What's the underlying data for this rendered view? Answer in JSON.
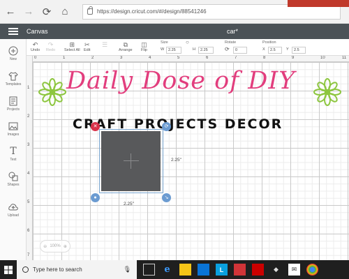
{
  "browser": {
    "url": "https://design.cricut.com/#/design/88541246"
  },
  "app": {
    "title": "Canvas",
    "document_name": "car*"
  },
  "left_panel": {
    "items": [
      {
        "label": "New",
        "icon": "plus-circle-icon"
      },
      {
        "label": "Templates",
        "icon": "shirt-icon"
      },
      {
        "label": "Projects",
        "icon": "projects-icon"
      },
      {
        "label": "Images",
        "icon": "image-icon"
      },
      {
        "label": "Text",
        "icon": "text-icon"
      },
      {
        "label": "Shapes",
        "icon": "shapes-icon"
      },
      {
        "label": "Upload",
        "icon": "upload-cloud-icon"
      }
    ]
  },
  "toolbar": {
    "undo": "Undo",
    "redo": "Redo",
    "select_all": "Select All",
    "edit": "Edit",
    "arrange": "Arrange",
    "flip": "Flip",
    "size_label": "Size",
    "w_label": "W",
    "h_label": "H",
    "width": "2.25",
    "height": "2.25",
    "rotate_label": "Rotate",
    "rotate": "0",
    "position_label": "Position",
    "x_label": "X",
    "y_label": "Y",
    "x": "2.5",
    "y": "2.5"
  },
  "ruler": {
    "top": [
      "0",
      "1",
      "2",
      "3",
      "4",
      "5",
      "6",
      "7",
      "8",
      "9",
      "10",
      "11"
    ],
    "left": [
      "1",
      "2",
      "3",
      "4",
      "5",
      "6",
      "7"
    ]
  },
  "overlay": {
    "title": "Daily Dose of DIY",
    "subtitle": "CRAFT PROJECTS DECOR",
    "accent_color": "#e23d7d",
    "flower_color": "#8dc63f"
  },
  "selection": {
    "width_label": "2.25\"",
    "height_label": "2.25\""
  },
  "zoom": {
    "value": "100%"
  },
  "taskbar": {
    "search_placeholder": "Type here to search",
    "apps": [
      {
        "icon": "task-view-icon",
        "label": ""
      },
      {
        "icon": "edge-icon",
        "label": "e"
      },
      {
        "icon": "file-explorer-icon",
        "label": ""
      },
      {
        "icon": "store-icon",
        "label": ""
      },
      {
        "icon": "app-l-icon",
        "label": "L"
      },
      {
        "icon": "app-red-icon",
        "label": ""
      },
      {
        "icon": "mcafee-icon",
        "label": ""
      },
      {
        "icon": "app-icon",
        "label": ""
      },
      {
        "icon": "mail-icon",
        "label": ""
      },
      {
        "icon": "chrome-icon",
        "label": ""
      }
    ]
  }
}
